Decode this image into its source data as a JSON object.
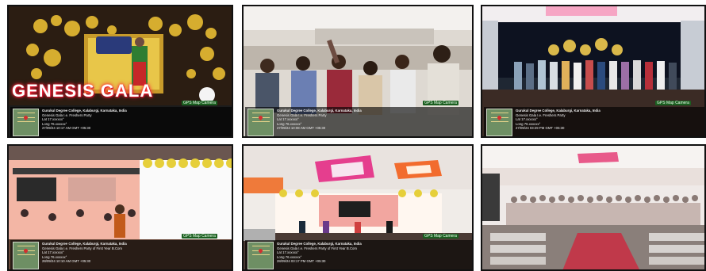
{
  "collage": {
    "tiles": [
      {
        "caption": "GENESIS GALA",
        "badge": "GPS Map Camera",
        "overlay": {
          "place": "Gurukul Degree College, Kalaburgi, Karnataka, India",
          "address": "Genesis Gala I.e. Freshers Party",
          "lat": "Lat 17.xxxxxx°",
          "long": "Long 76.xxxxxx°",
          "datetime": "27/09/24 10:17 AM GMT +05:30"
        }
      },
      {
        "badge": "GPS Map Camera",
        "overlay": {
          "place": "Gurukul Degree College, Kalaburgi, Karnataka, India",
          "address": "Genesis Gala I.e. Freshers Party",
          "lat": "Lat 17.xxxxxx°",
          "long": "Long 76.xxxxxx°",
          "datetime": "27/09/24 10:08 AM GMT +05:30"
        }
      },
      {
        "badge": "GPS Map Camera",
        "overlay": {
          "place": "Gurukul Degree College, Kalaburgi, Karnataka, India",
          "address": "Genesis Gala I.e. Freshers Party",
          "lat": "Lat 17.xxxxxx°",
          "long": "Long 76.xxxxxx°",
          "datetime": "27/09/24 03:29 PM GMT +05:30"
        }
      },
      {
        "badge": "GPS Map Camera",
        "overlay": {
          "place": "Gurukul Degree College, Kalaburgi, Karnataka, India",
          "address": "Genesis Gala I.e. Freshers Party of First Year B.Com",
          "lat": "Lat 17.xxxxxx°",
          "long": "Long 76.xxxxxx°",
          "datetime": "28/09/24 10:10 AM GMT +05:30"
        }
      },
      {
        "badge": "GPS Map Camera",
        "overlay": {
          "place": "Gurukul Degree College, Kalaburgi, Karnataka, India",
          "address": "Genesis Gala I.e. Freshers Party of First Year B.Com",
          "lat": "Lat 17.xxxxxx°",
          "long": "Long 76.xxxxxx°",
          "datetime": "28/09/24 03:17 PM GMT +05:30"
        }
      },
      {}
    ]
  }
}
